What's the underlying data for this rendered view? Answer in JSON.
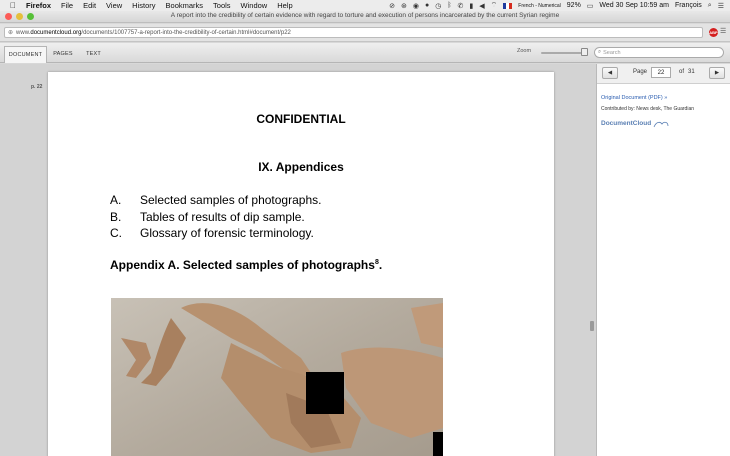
{
  "menubar": {
    "app": "Firefox",
    "items": [
      "File",
      "Edit",
      "View",
      "History",
      "Bookmarks",
      "Tools",
      "Window",
      "Help"
    ],
    "input_source": "French - Numerical",
    "battery": "92%",
    "datetime": "Wed 30 Sep  10:59 am",
    "user": "François"
  },
  "window": {
    "title": "A report into the credibility of certain evidence with regard to torture and execution of persons incarcerated by the current Syrian regime"
  },
  "urlbar": {
    "prefix": "www.",
    "host": "documentcloud.org",
    "path": "/documents/1007757-a-report-into-the-credibility-of-certain.html#document/p22",
    "addon_label": "ABP"
  },
  "dc_toolbar": {
    "tabs": [
      "DOCUMENT",
      "PAGES",
      "TEXT"
    ],
    "zoom_label": "Zoom",
    "zoom_level": 0.85,
    "search_placeholder": "Search"
  },
  "document": {
    "page_label": "p. 22",
    "confidential": "CONFIDENTIAL",
    "section_title": "IX. Appendices",
    "list": [
      {
        "marker": "A.",
        "text": "Selected samples of photographs."
      },
      {
        "marker": "B.",
        "text": "Tables of results of dip sample."
      },
      {
        "marker": "C.",
        "text": "Glossary of forensic terminology."
      }
    ],
    "appendix_heading": "Appendix A. Selected samples of photographs",
    "appendix_footnote": "8",
    "appendix_heading_suffix": "."
  },
  "sidebar": {
    "prev": "◀",
    "next": "▶",
    "page_word": "Page",
    "current_page": "22",
    "of_word": "of",
    "total_pages": "31",
    "original_link": "Original Document (PDF) »",
    "contributed": "Contributed by: News desk, The Guardian",
    "logo_text": "DocumentCloud"
  }
}
